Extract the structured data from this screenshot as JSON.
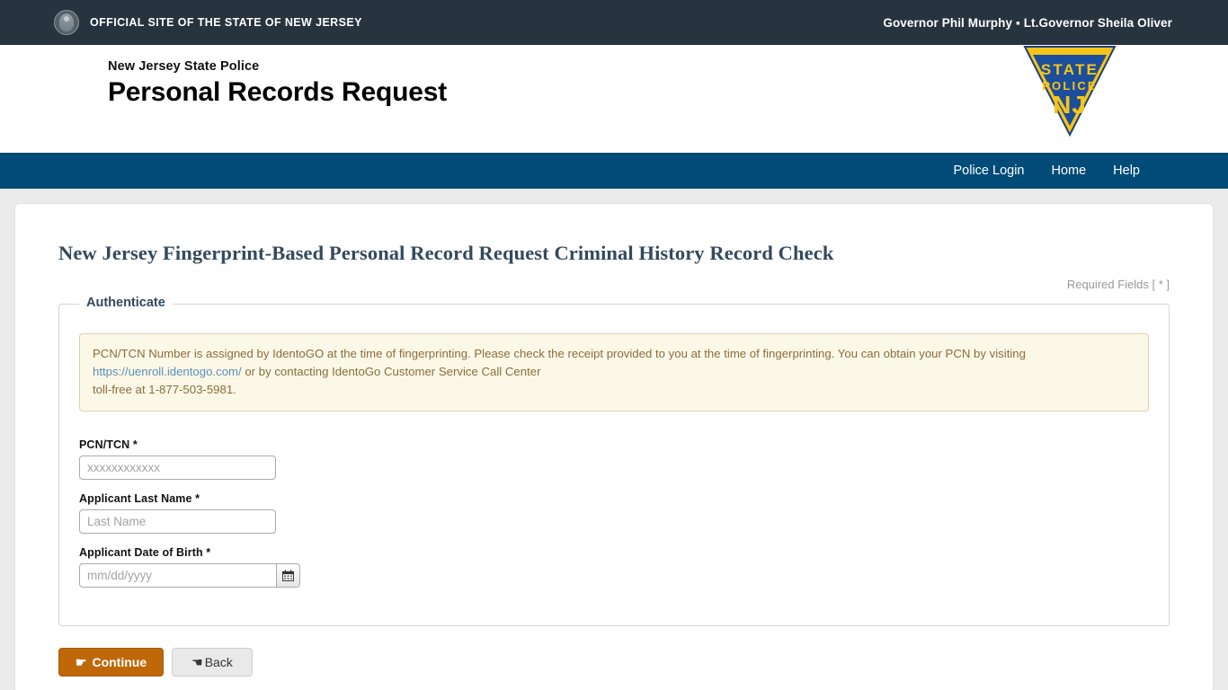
{
  "state_bar": {
    "seal_icon": "nj-state-seal-icon",
    "official_site_text": "OFFICIAL SITE OF THE STATE OF NEW JERSEY",
    "governor_text": "Governor Phil Murphy ▪ Lt.Governor Sheila Oliver"
  },
  "masthead": {
    "agency_name": "New Jersey State Police",
    "page_title": "Personal Records Request",
    "logo": {
      "name": "nj-state-police-triangle-logo",
      "line1": "STATE",
      "line2": "POLICE",
      "line3": "NJ",
      "border_color": "#f5c518",
      "fill_color": "#1c4e9c",
      "text_color": "#f5c518"
    }
  },
  "nav": {
    "background_color": "#004b78",
    "items": [
      {
        "label": "Police Login",
        "name": "nav-police-login"
      },
      {
        "label": "Home",
        "name": "nav-home"
      },
      {
        "label": "Help",
        "name": "nav-help"
      }
    ]
  },
  "main": {
    "heading": "New Jersey Fingerprint-Based Personal Record Request Criminal History Record Check",
    "required_fields_note": "Required Fields [ * ]",
    "fieldset_legend": "Authenticate",
    "alert": {
      "text_before_link": "PCN/TCN Number is assigned by IdentoGO at the time of fingerprinting. Please check the receipt provided to you at the time of fingerprinting. You can obtain your PCN by visiting ",
      "link_text": "https://uenroll.identogo.com/",
      "text_after_link": " or by contacting IdentoGo Customer Service Call Center",
      "text_line3": "toll-free at 1-877-503-5981.",
      "background_color": "#fcf8e8",
      "border_color": "#ddd1b0",
      "text_color": "#8a6d3b",
      "link_color": "#5b8fb9"
    },
    "fields": [
      {
        "name": "pcn-tcn-input",
        "label": "PCN/TCN *",
        "value": "",
        "placeholder": "xxxxxxxxxxxx"
      },
      {
        "name": "applicant-last-name-input",
        "label": "Applicant Last Name *",
        "value": "",
        "placeholder": "Last Name"
      },
      {
        "name": "applicant-date-of-birth-input",
        "label": "Applicant Date of Birth *",
        "value": "",
        "placeholder": "mm/dd/yyyy",
        "calendar_icon": "calendar-icon"
      }
    ],
    "buttons": {
      "continue": {
        "label": "Continue",
        "icon": "☛",
        "icon_name": "pointing-hand-right-icon",
        "color": "#bf6809"
      },
      "back": {
        "label": "Back",
        "icon": "☚",
        "icon_name": "pointing-hand-left-icon",
        "color": "#e9e9e9"
      }
    }
  }
}
